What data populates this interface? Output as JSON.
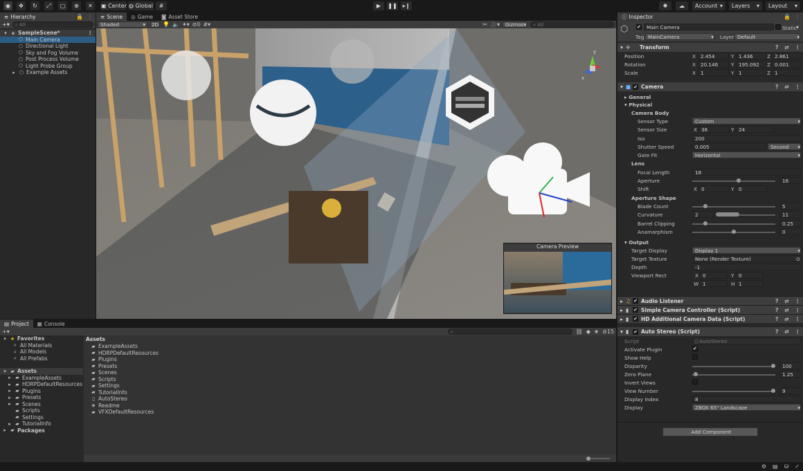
{
  "toolbar": {
    "tools": [
      "view-tool-icon",
      "move-tool-icon",
      "rotate-tool-icon",
      "scale-tool-icon",
      "rect-tool-icon",
      "transform-tool-icon",
      "custom-tool-icon"
    ],
    "pivot": "Center",
    "space": "Global",
    "account": "Account",
    "layers": "Layers",
    "layout": "Layout"
  },
  "hierarchy": {
    "tab": "Hierarchy",
    "search_placeholder": "All",
    "scene": "SampleScene*",
    "items": [
      "Main Camera",
      "Directional Light",
      "Sky and Fog Volume",
      "Post Process Volume",
      "Light Probe Group",
      "Example Assets"
    ]
  },
  "scene": {
    "tabs": [
      "Scene",
      "Game",
      "Asset Store"
    ],
    "shading": "Shaded",
    "mode2d": "2D",
    "hidden_count": "0",
    "gizmos": "Gizmos",
    "search_placeholder": "All",
    "axis_labels": [
      "y",
      "x"
    ],
    "preview_title": "Camera Preview"
  },
  "project": {
    "tabs": [
      "Project",
      "Console"
    ],
    "favorites": "Favorites",
    "fav_items": [
      "All Materials",
      "All Models",
      "All Prefabs"
    ],
    "assets": "Assets",
    "tree": [
      "ExampleAssets",
      "HDRPDefaultResources",
      "Plugins",
      "Presets",
      "Scenes",
      "Scripts",
      "Settings",
      "TutorialInfo"
    ],
    "packages": "Packages",
    "breadcrumb": "Assets",
    "list": [
      "ExampleAssets",
      "HDRPDefaultResources",
      "Plugins",
      "Presets",
      "Scenes",
      "Scripts",
      "Settings",
      "TutorialInfo",
      "AutoStereo",
      "Readme",
      "VFXDefaultResources"
    ],
    "hidden_count": "15"
  },
  "inspector": {
    "tab": "Inspector",
    "name": "Main Camera",
    "static": "Static",
    "tag_label": "Tag",
    "tag": "MainCamera",
    "layer_label": "Layer",
    "layer": "Default",
    "transform": {
      "title": "Transform",
      "rows": [
        {
          "label": "Position",
          "x": "2.454",
          "y": "1.436",
          "z": "2.861"
        },
        {
          "label": "Rotation",
          "x": "20.146",
          "y": "195.092",
          "z": "0.001"
        },
        {
          "label": "Scale",
          "x": "1",
          "y": "1",
          "z": "1"
        }
      ]
    },
    "camera": {
      "title": "Camera",
      "general": "General",
      "physical": "Physical",
      "camera_body": "Camera Body",
      "sensor_type_label": "Sensor Type",
      "sensor_type": "Custom",
      "sensor_size_label": "Sensor Size",
      "sensor_x": "36",
      "sensor_y": "24",
      "iso_label": "Iso",
      "iso": "200",
      "shutter_label": "Shutter Speed",
      "shutter": "0.005",
      "shutter_unit": "Second",
      "gate_label": "Gate Fit",
      "gate": "Horizontal",
      "lens": "Lens",
      "focal_label": "Focal Length",
      "focal": "18",
      "aperture_label": "Aperture",
      "aperture": "16",
      "shift_label": "Shift",
      "shift_x": "0",
      "shift_y": "0",
      "aperture_shape": "Aperture Shape",
      "blade_label": "Blade Count",
      "blade": "5",
      "curv_label": "Curvature",
      "curv_min": "2",
      "curv_max": "11",
      "barrel_label": "Barrel Clipping",
      "barrel": "0.25",
      "anam_label": "Anamorphism",
      "anam": "0",
      "output": "Output",
      "target_display_label": "Target Display",
      "target_display": "Display 1",
      "target_tex_label": "Target Texture",
      "target_tex": "None (Render Texture)",
      "depth_label": "Depth",
      "depth": "-1",
      "viewport_label": "Viewport Rect",
      "vp_x": "0",
      "vp_y": "0",
      "vp_w": "1",
      "vp_h": "1"
    },
    "components": [
      "Audio Listener",
      "Simple Camera Controller (Script)",
      "HD Additional Camera Data (Script)"
    ],
    "autostereo": {
      "title": "Auto Stereo (Script)",
      "script_label": "Script",
      "script": "AutoStereo",
      "activate_label": "Activate Plugin",
      "help_label": "Show Help",
      "disparity_label": "Disparity",
      "disparity": "100",
      "zero_label": "Zero Plane",
      "zero": "1.25",
      "invert_label": "Invert Views",
      "viewnum_label": "View Number",
      "viewnum": "9",
      "dindex_label": "Display Index",
      "dindex": "8",
      "display_label": "Display",
      "display": "ZBOX 65\" Landscape"
    },
    "add_component": "Add Component"
  },
  "sliders": {
    "aperture": 0.56,
    "blade": 0.14,
    "barrel": 0.14,
    "anam": 0.5,
    "disparity": 1.0,
    "zero": 0.02,
    "viewnum": 1.0
  }
}
